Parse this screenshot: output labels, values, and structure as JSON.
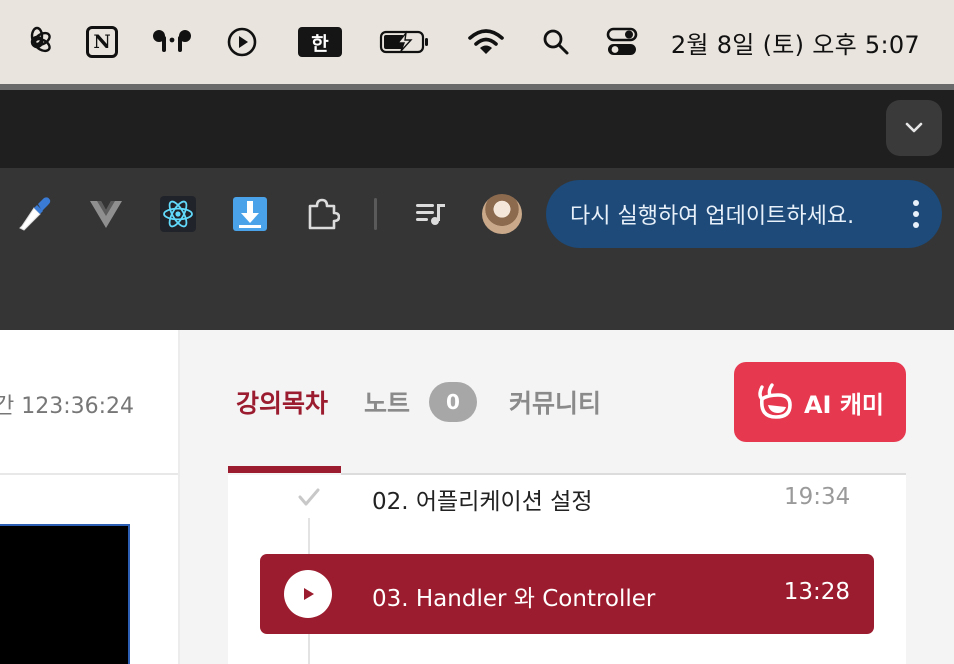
{
  "menubar": {
    "icons": [
      "openai-icon",
      "notion-icon",
      "airpods-icon",
      "play-circle-icon",
      "input-source-icon",
      "battery-charging-icon",
      "wifi-icon",
      "search-icon",
      "control-center-icon"
    ],
    "input_source": "한",
    "notion_letter": "N",
    "clock": "2월 8일 (토) 오후 5:07"
  },
  "browser": {
    "extensions": [
      "eyedropper-icon",
      "vue-devtools-icon",
      "react-devtools-icon",
      "download-icon",
      "puzzle-extensions-icon",
      "media-queue-icon"
    ],
    "update_notice": "다시 실행하여 업데이트하세요."
  },
  "left_panel": {
    "total_time": "간 123:36:24"
  },
  "right_panel": {
    "tabs": [
      {
        "label": "강의목차",
        "active": true
      },
      {
        "label": "노트",
        "count": "0"
      },
      {
        "label": "커뮤니티"
      }
    ],
    "ai_button_label": "AI 캐미",
    "lectures": [
      {
        "title": "02. 어플리케이션 설정",
        "duration": "19:34",
        "completed": true
      },
      {
        "title": "03. Handler 와 Controller",
        "duration": "13:28",
        "current": true
      }
    ]
  },
  "colors": {
    "accent": "#9b1c2e",
    "ai_button": "#e63950",
    "update_pill": "#1d4a78",
    "menubar": "#e9e4de"
  }
}
